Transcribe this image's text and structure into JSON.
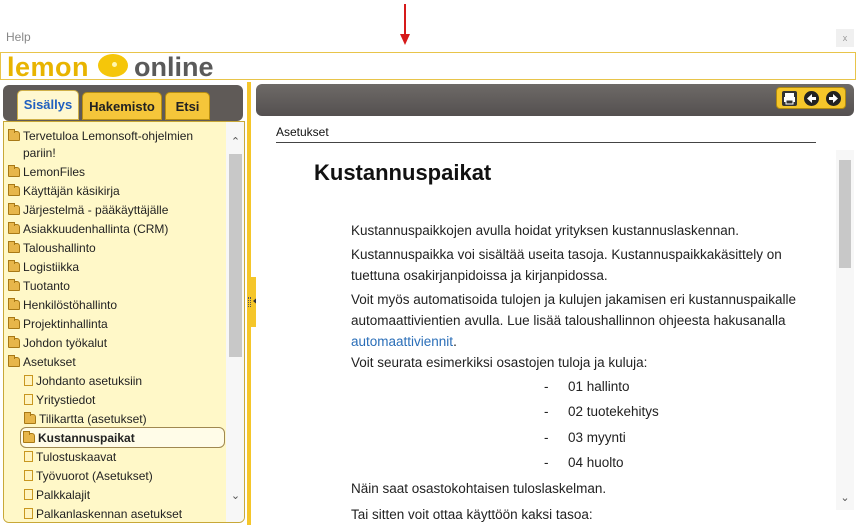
{
  "header": {
    "help_label": "Help",
    "logo_left": "lemon",
    "logo_right": "online",
    "close_label": "x"
  },
  "tabs": [
    {
      "label": "Sisällys",
      "active": true
    },
    {
      "label": "Hakemisto",
      "active": false
    },
    {
      "label": "Etsi",
      "active": false
    }
  ],
  "tree": [
    {
      "label": "Tervetuloa Lemonsoft-ohjelmien",
      "icon": "folder-icon"
    },
    {
      "label": "pariin!",
      "icon": "none"
    },
    {
      "label": "LemonFiles",
      "icon": "folder-icon"
    },
    {
      "label": "Käyttäjän käsikirja",
      "icon": "folder-icon"
    },
    {
      "label": "Järjestelmä - pääkäyttäjälle",
      "icon": "folder-icon"
    },
    {
      "label": "Asiakkuudenhallinta (CRM)",
      "icon": "folder-icon"
    },
    {
      "label": "Taloushallinto",
      "icon": "folder-icon"
    },
    {
      "label": "Logistiikka",
      "icon": "folder-icon"
    },
    {
      "label": "Tuotanto",
      "icon": "folder-icon"
    },
    {
      "label": "Henkilöstöhallinto",
      "icon": "folder-icon"
    },
    {
      "label": "Projektinhallinta",
      "icon": "folder-icon"
    },
    {
      "label": "Johdon työkalut",
      "icon": "folder-icon"
    },
    {
      "label": "Asetukset",
      "icon": "folder-open-icon"
    },
    {
      "label": "Johdanto asetuksiin",
      "icon": "page-icon"
    },
    {
      "label": "Yritystiedot",
      "icon": "page-icon"
    },
    {
      "label": "Tilikartta (asetukset)",
      "icon": "folder-icon"
    },
    {
      "label": "Kustannuspaikat",
      "icon": "folder-open-icon",
      "selected": true
    },
    {
      "label": "Tulostuskaavat",
      "icon": "page-icon"
    },
    {
      "label": "Työvuorot (Asetukset)",
      "icon": "page-icon"
    },
    {
      "label": "Palkkalajit",
      "icon": "page-icon"
    },
    {
      "label": "Palkanlaskennan asetukset",
      "icon": "page-icon"
    }
  ],
  "toolbar": {
    "print_icon": "print-icon",
    "back_icon": "arrow-left-icon",
    "forward_icon": "arrow-right-icon"
  },
  "content": {
    "breadcrumb": "Asetukset",
    "title": "Kustannuspaikat",
    "p1": "Kustannuspaikkojen avulla hoidat yrityksen kustannuslaskennan.",
    "p2": "Kustannuspaikka voi sisältää useita tasoja. Kustannuspaikkakäsittely on tuettuna osakirjanpidoissa ja kirjanpidossa.",
    "p3_before": "Voit myös automatisoida tulojen ja kulujen jakamisen eri kustannuspaikalle automaattivientien avulla. Lue lisää taloushallinnon ohjeesta hakusanalla ",
    "p3_link": "automaattiviennit",
    "p3_after": ".",
    "p4": "Voit seurata esimerkiksi osastojen tuloja ja kuluja:",
    "bullets": [
      "01 hallinto",
      "02 tuotekehitys",
      "03 myynti",
      "04 huolto"
    ],
    "bullet_mark": "-",
    "p5": "Näin saat osastokohtaisen tuloslaskelman.",
    "p6": "Tai sitten voit ottaa käyttöön kaksi tasoa:"
  },
  "colors": {
    "accent": "#f5c62a",
    "toolbar_dark": "#5f5a57",
    "link": "#2a6eb8",
    "tree_bg": "#fff8c8"
  }
}
